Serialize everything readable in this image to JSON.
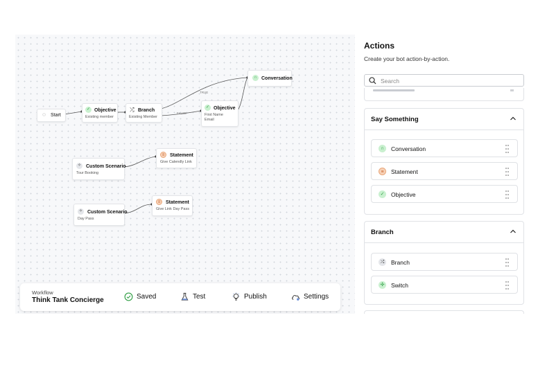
{
  "canvas": {
    "nodes": {
      "start": {
        "title": "Start",
        "icon": "chat-icon"
      },
      "objective1": {
        "title": "Objective",
        "sub": [
          "Existing member"
        ],
        "icon": "check-icon"
      },
      "branch": {
        "title": "Branch",
        "sub": [
          "Existing Member"
        ],
        "icon": "branch-icon"
      },
      "objective2": {
        "title": "Objective",
        "sub": [
          "First Name",
          "Email"
        ],
        "icon": "check-icon"
      },
      "conversation": {
        "title": "Conversation",
        "icon": "headset-icon"
      },
      "custom1": {
        "title": "Custom Scenario",
        "sub": [
          "Tour Booking"
        ],
        "icon": "sparkle-icon"
      },
      "statement1": {
        "title": "Statement",
        "sub": [
          "Give Calendly Link"
        ],
        "icon": "statement-icon"
      },
      "custom2": {
        "title": "Custom Scenario",
        "sub": [
          "Day Pass"
        ],
        "icon": "sparkle-icon"
      },
      "statement2": {
        "title": "Statement",
        "sub": [
          "Give Link Day Pass"
        ],
        "icon": "statement-icon"
      }
    },
    "edge_labels": {
      "true": "TRUE",
      "false": "FALSE"
    }
  },
  "toolbar": {
    "workflow_label": "Workflow",
    "workflow_title": "Think Tank Concierge",
    "saved": "Saved",
    "test": "Test",
    "publish": "Publish",
    "settings": "Settings"
  },
  "actions": {
    "title": "Actions",
    "subtitle": "Create your bot action-by-action.",
    "search_placeholder": "Search",
    "groups": [
      {
        "title": "Say Something",
        "items": [
          {
            "label": "Conversation",
            "icon": "headset-icon"
          },
          {
            "label": "Statement",
            "icon": "statement-icon"
          },
          {
            "label": "Objective",
            "icon": "check-icon"
          }
        ]
      },
      {
        "title": "Branch",
        "items": [
          {
            "label": "Branch",
            "icon": "branch-icon"
          },
          {
            "label": "Switch",
            "icon": "switch-icon"
          }
        ]
      }
    ]
  },
  "colors": {
    "green": "#2f9e44",
    "green_bg": "#c9f0cf",
    "orange": "#c8612a",
    "orange_bg": "#f7d2b8",
    "connector": "#444444"
  }
}
